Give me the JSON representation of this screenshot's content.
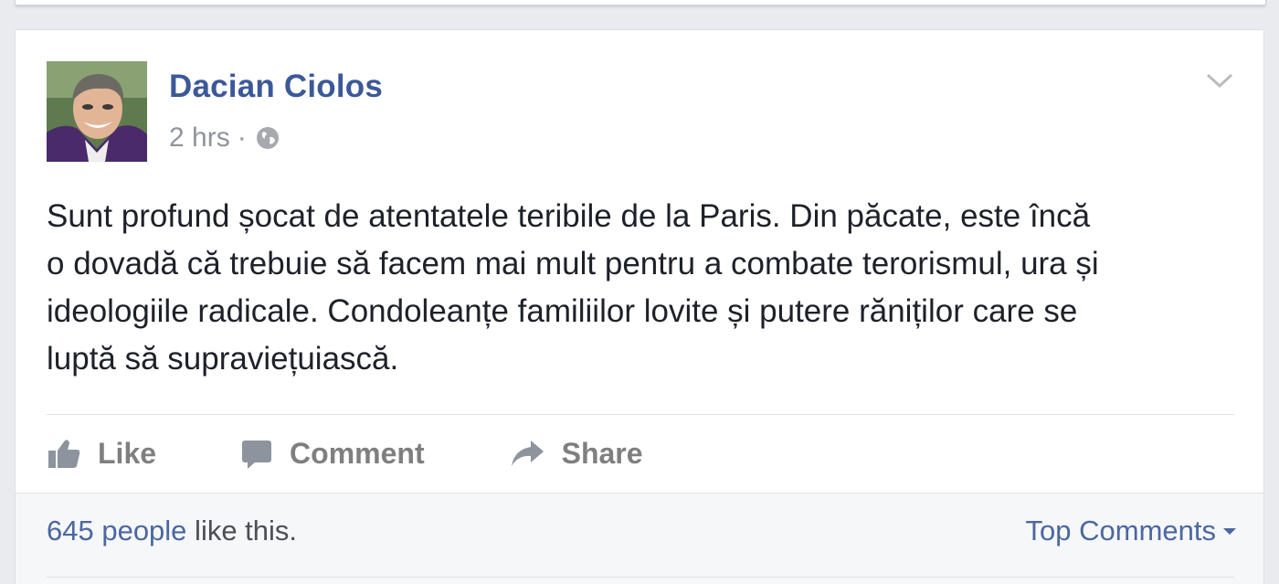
{
  "post": {
    "author": "Dacian Ciolos",
    "time": "2 hrs",
    "separator": "·",
    "privacy_icon": "globe-icon",
    "text": "Sunt profund șocat de atentatele teribile de la Paris. Din păcate, este încă\no dovadă că trebuie să facem mai mult pentru a combate terorismul, ura și\nideologiile radicale. Condoleanțe familiilor lovite și putere răniților care se\nluptă să supraviețuiască."
  },
  "actions": {
    "like": "Like",
    "comment": "Comment",
    "share": "Share"
  },
  "footer": {
    "likes_count": "645 people",
    "likes_suffix": " like this.",
    "top_comments": "Top Comments"
  },
  "colors": {
    "author_link": "#3b5998",
    "meta_gray": "#90949c",
    "action_gray": "#7f7f7f",
    "body_text": "#1d2129",
    "link_blue": "#4b67a1"
  }
}
